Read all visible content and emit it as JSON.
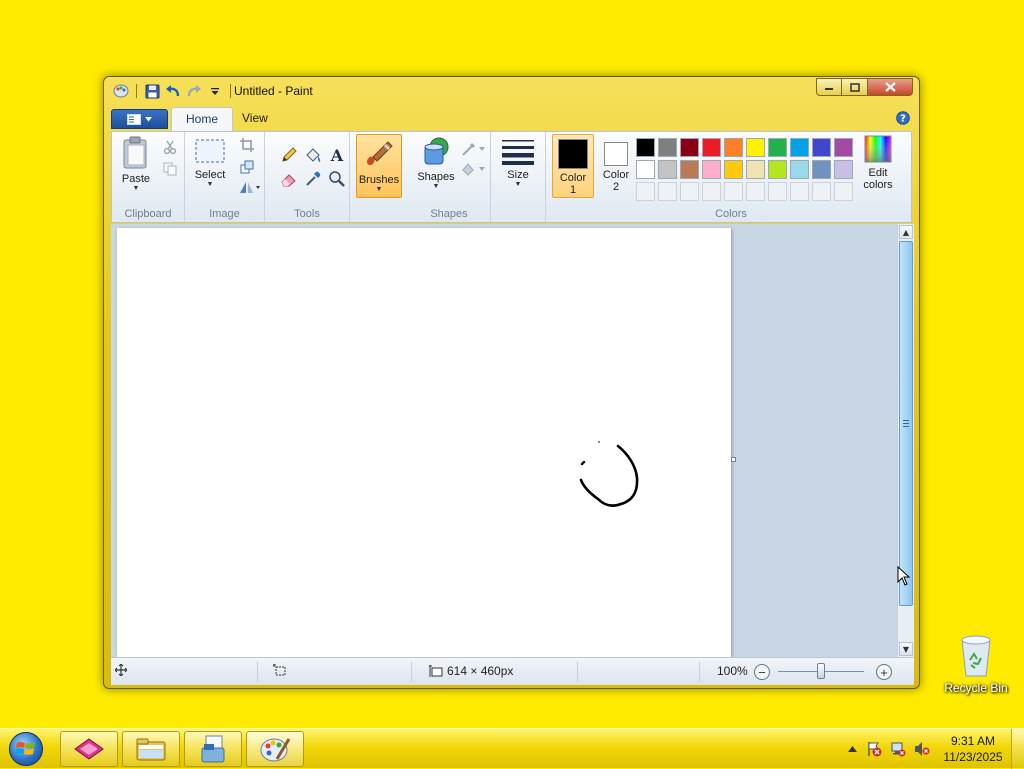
{
  "window": {
    "title": "Untitled - Paint",
    "controls": {
      "minimize": "minimize-icon",
      "maximize": "maximize-icon",
      "close": "close-icon"
    }
  },
  "quick_access": [
    "paint-app-icon",
    "save-icon",
    "undo-icon",
    "redo-icon",
    "customize-dropdown-icon"
  ],
  "ribbon": {
    "tabs": [
      {
        "label": "Home",
        "active": true
      },
      {
        "label": "View",
        "active": false
      }
    ],
    "groups": {
      "clipboard": {
        "label": "Clipboard",
        "paste": "Paste"
      },
      "image": {
        "label": "Image",
        "select": "Select"
      },
      "tools": {
        "label": "Tools"
      },
      "brushes": {
        "label": "Brushes"
      },
      "shapes": {
        "label": "Shapes",
        "shapes_button": "Shapes"
      },
      "size": {
        "label": "Size"
      },
      "colors": {
        "label": "Colors",
        "color1": "Color\n1",
        "color2": "Color\n2",
        "edit": "Edit\ncolors",
        "color1_value": "#000000",
        "color2_value": "#ffffff",
        "palette": [
          "#000000",
          "#7f7f7f",
          "#880015",
          "#ed1c24",
          "#ff7f27",
          "#fff200",
          "#22b14c",
          "#00a2e8",
          "#3f48cc",
          "#a349a4",
          "#ffffff",
          "#c3c3c3",
          "#b97a57",
          "#ffaec9",
          "#ffc90e",
          "#efe4b0",
          "#b5e61d",
          "#99d9ea",
          "#7092be",
          "#c8bfe7",
          "",
          "",
          "",
          "",
          "",
          "",
          "",
          "",
          "",
          ""
        ]
      }
    }
  },
  "status": {
    "canvas_size": "614 × 460px",
    "zoom": "100%",
    "zoom_level": 1.0
  },
  "desktop": {
    "recycle_bin": "Recycle Bin"
  },
  "taskbar": {
    "apps": [
      "media-center-icon",
      "file-explorer-icon",
      "documents-icon",
      "paint-taskbar-icon"
    ],
    "time": "9:31 AM",
    "date": "11/23/2025"
  }
}
